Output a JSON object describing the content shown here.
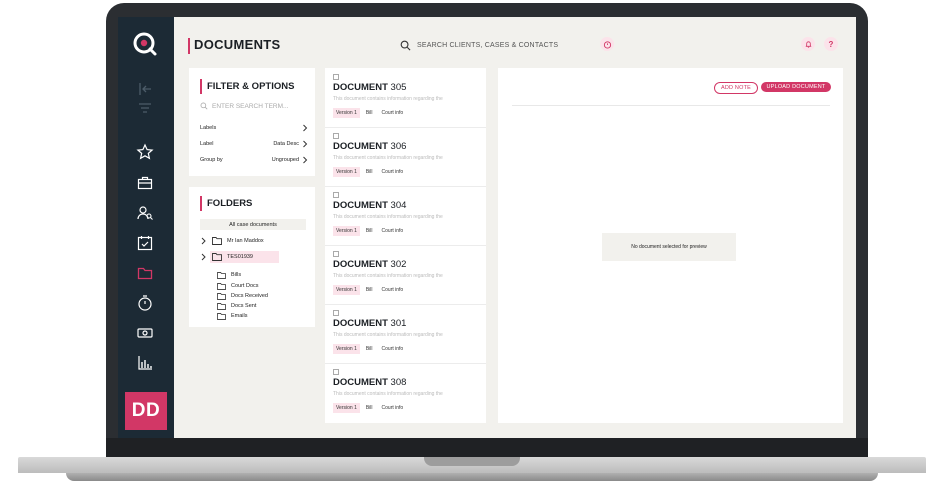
{
  "header": {
    "title": "DOCUMENTS",
    "search_placeholder": "SEARCH CLIENTS, CASES & CONTACTS",
    "help_label": "?"
  },
  "sidebar": {
    "icons": [
      "logo-icon",
      "collapse-icon",
      "filter-icon",
      "star-icon",
      "briefcase-icon",
      "contacts-icon",
      "calendar-check-icon",
      "folder-icon",
      "timer-icon",
      "money-icon",
      "reports-icon"
    ],
    "active": "folder-icon",
    "avatar_initials": "DD"
  },
  "filter": {
    "title": "FILTER & OPTIONS",
    "search_placeholder": "ENTER SEARCH TERM...",
    "rows": [
      {
        "label": "Labels",
        "value": ""
      },
      {
        "label": "Label",
        "value": "Data Desc"
      },
      {
        "label": "Group by",
        "value": "Ungrouped"
      }
    ]
  },
  "folders": {
    "title": "FOLDERS",
    "all_label": "All case documents",
    "top_level": [
      {
        "label": "Mr Ian Maddox",
        "active": false
      },
      {
        "label": "TES01939",
        "active": true
      }
    ],
    "sub_folders": [
      "Bills",
      "Court Docs",
      "Docs Received",
      "Docs Sent",
      "Emails"
    ]
  },
  "documents": [
    {
      "prefix": "DOCUMENT",
      "number": "305",
      "desc": "This document contains information regarding the",
      "tags": [
        "Version 1",
        "Bill",
        "Court info"
      ]
    },
    {
      "prefix": "DOCUMENT",
      "number": "306",
      "desc": "This document contains information regarding the",
      "tags": [
        "Version 1",
        "Bill",
        "Court info"
      ]
    },
    {
      "prefix": "DOCUMENT",
      "number": "304",
      "desc": "This document contains information regarding the",
      "tags": [
        "Version 1",
        "Bill",
        "Court info"
      ]
    },
    {
      "prefix": "DOCUMENT",
      "number": "302",
      "desc": "This document contains information regarding the",
      "tags": [
        "Version 1",
        "Bill",
        "Court info"
      ]
    },
    {
      "prefix": "DOCUMENT",
      "number": "301",
      "desc": "This document contains information regarding the",
      "tags": [
        "Version 1",
        "Bill",
        "Court info"
      ]
    },
    {
      "prefix": "DOCUMENT",
      "number": "308",
      "desc": "This document contains information regarding the",
      "tags": [
        "Version 1",
        "Bill",
        "Court info"
      ]
    }
  ],
  "preview": {
    "add_note_label": "ADD NOTE",
    "upload_label": "UPLOAD DOCUMENT",
    "empty_message": "No document selected for preview"
  },
  "colors": {
    "accent": "#d23766",
    "sidebar_bg": "#1c2a35",
    "page_bg": "#f2f1ed"
  }
}
